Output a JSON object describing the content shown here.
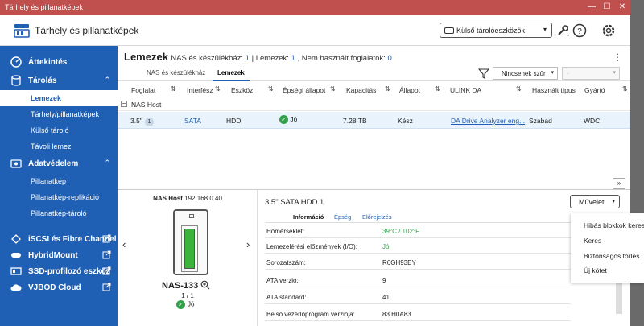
{
  "window": {
    "title": "Tárhely és pillanatképek",
    "minimize": "—",
    "maximize": "☐",
    "close": "✕"
  },
  "header": {
    "app_title": "Tárhely és pillanatképek",
    "ext_button": "Külső tárolóeszközök"
  },
  "sidebar": {
    "overview": "Áttekintés",
    "storage": "Tárolás",
    "storage_items": [
      "Lemezek",
      "Tárhely/pillanatképek",
      "Külső tároló",
      "Távoli lemez"
    ],
    "protection": "Adatvédelem",
    "protection_items": [
      "Pillanatkép",
      "Pillanatkép-replikáció",
      "Pillanatkép-tároló"
    ],
    "iscsi": "iSCSI és Fibre Channel",
    "hybridmount": "HybridMount",
    "ssd": "SSD-profilozó eszköz",
    "vjbod": "VJBOD Cloud",
    "collapse_arrow": "⌃"
  },
  "main": {
    "title": "Lemezek",
    "summary": {
      "nas_label": "NAS és készülékház: ",
      "nas_val": "1",
      "disks_label": " | Lemezek: ",
      "disks_val": "1",
      "free_label": " , Nem használt foglalatok: ",
      "free_val": "0"
    },
    "tabs": [
      "NAS és készülékház",
      "Lemezek"
    ],
    "filter": "Nincsenek szűr",
    "search": "-",
    "columns": [
      "Foglalat",
      "Interfész",
      "Eszköz",
      "Épségi állapot",
      "Kapacitás",
      "Állapot",
      "ULINK DA",
      "Használt típus",
      "Gyártó"
    ],
    "group": "NAS Host",
    "row": {
      "slot": "3.5\"",
      "slot_badge": "1",
      "iface": "SATA",
      "device": "HDD",
      "health": "Jó",
      "capacity": "7.28 TB",
      "status": "Kész",
      "ulink": "DA Drive Analyzer eng...",
      "used": "Szabad",
      "vendor": "WDC"
    }
  },
  "detail": {
    "nas_host_label": "NAS Host",
    "nas_ip": "192.168.0.40",
    "nas_name": "NAS-133",
    "bays": "1 / 1",
    "status": "Jó",
    "disk_title": "3.5\" SATA HDD 1",
    "action": "Művelet",
    "tabs": [
      "Információ",
      "Épség",
      "Előrejelzés"
    ],
    "props": [
      {
        "k": "Hőmérséklet:",
        "v": "39°C / 102°F"
      },
      {
        "k": "Lemezelérési előzmények (I/O):",
        "v": "Jó"
      },
      {
        "k": "Sorozatszám:",
        "v": "R6GH93EY"
      },
      {
        "k": "ATA verzió:",
        "v": "9"
      },
      {
        "k": "ATA standard:",
        "v": "41"
      },
      {
        "k": "Belső vezérlőprogram verziója:",
        "v": "83.H0A83"
      }
    ]
  },
  "menu": [
    "Hibás blokkok keresése",
    "Keres",
    "Biztonságos törlés",
    "Új kötet"
  ],
  "colors": {
    "accent": "#1f5fb4",
    "titlebar": "#c0504d",
    "ok": "#2fa24a"
  }
}
